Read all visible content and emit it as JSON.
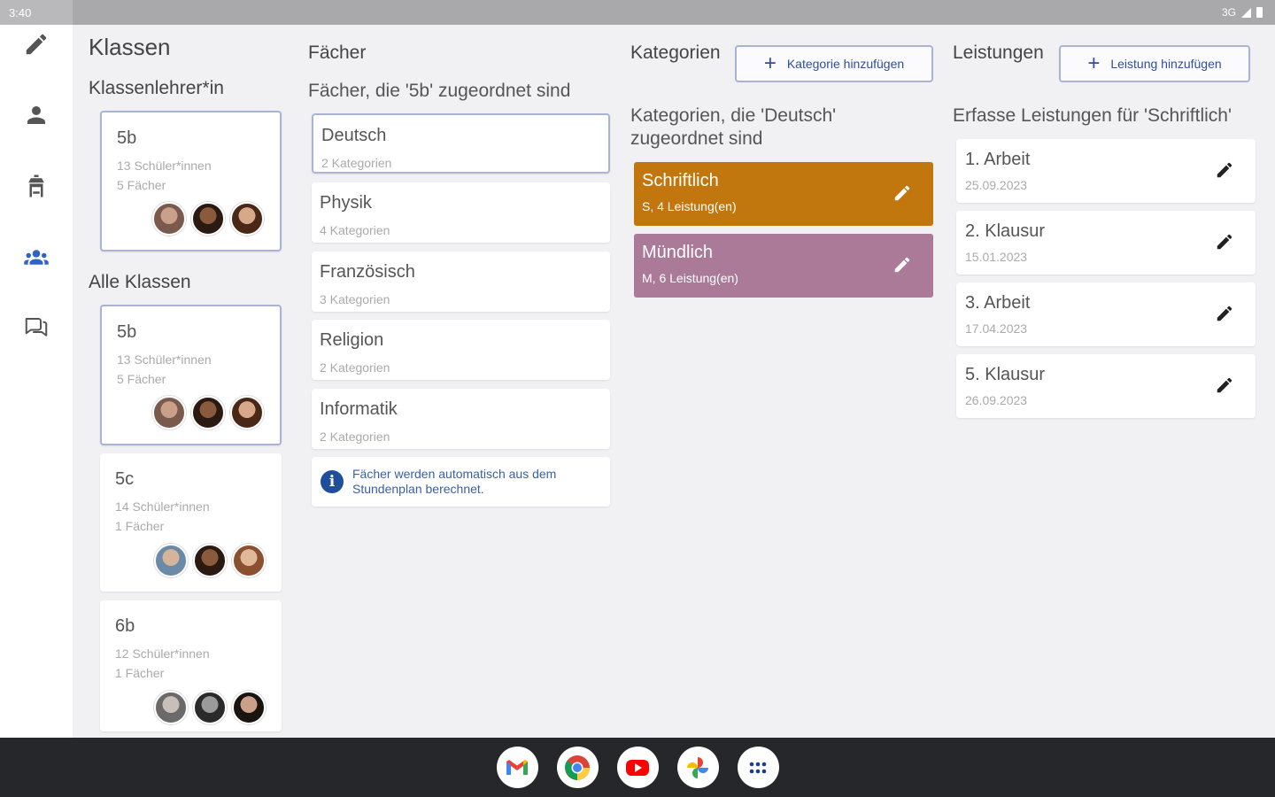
{
  "status": {
    "time": "3:40",
    "network": "3G"
  },
  "nav": {
    "items": [
      {
        "name": "edit"
      },
      {
        "name": "person"
      },
      {
        "name": "school"
      },
      {
        "name": "groups",
        "active": true
      },
      {
        "name": "chat"
      }
    ],
    "active_color": "#2f63c4"
  },
  "classes": {
    "title": "Klassen",
    "teacher_heading": "Klassenlehrer*in",
    "all_heading": "Alle Klassen",
    "teacher_class": {
      "name": "5b",
      "students": "13 Schüler*innen",
      "subjects": "5 Fächer"
    },
    "list": [
      {
        "name": "5b",
        "students": "13 Schüler*innen",
        "subjects": "5 Fächer"
      },
      {
        "name": "5c",
        "students": "14 Schüler*innen",
        "subjects": "1 Fächer"
      },
      {
        "name": "6b",
        "students": "12 Schüler*innen",
        "subjects": "1 Fächer"
      }
    ]
  },
  "subjects": {
    "title": "Fächer",
    "subtitle": "Fächer, die '5b' zugeordnet sind",
    "items": [
      {
        "name": "Deutsch",
        "meta": "2 Kategorien"
      },
      {
        "name": "Physik",
        "meta": "4 Kategorien"
      },
      {
        "name": "Französisch",
        "meta": "3 Kategorien"
      },
      {
        "name": "Religion",
        "meta": "2 Kategorien"
      },
      {
        "name": "Informatik",
        "meta": "2 Kategorien"
      }
    ],
    "info": "Fächer werden automatisch aus dem Stundenplan berechnet."
  },
  "categories": {
    "title": "Kategorien",
    "add_label": "Kategorie hinzufügen",
    "subtitle_line1": "Kategorien, die 'Deutsch'",
    "subtitle_line2": "zugeordnet sind",
    "items": [
      {
        "name": "Schriftlich",
        "meta": "S, 4 Leistung(en)",
        "color": "#c2760e"
      },
      {
        "name": "Mündlich",
        "meta": "M, 6 Leistung(en)",
        "color": "#ab7a98"
      }
    ]
  },
  "performances": {
    "title": "Leistungen",
    "add_label": "Leistung hinzufügen",
    "subtitle": "Erfasse Leistungen für 'Schriftlich'",
    "items": [
      {
        "name": "1. Arbeit",
        "date": "25.09.2023"
      },
      {
        "name": "2. Klausur",
        "date": "15.01.2023"
      },
      {
        "name": "3. Arbeit",
        "date": "17.04.2023"
      },
      {
        "name": "5. Klausur",
        "date": "26.09.2023"
      }
    ]
  },
  "taskbar": {
    "apps": [
      "gmail",
      "chrome",
      "youtube",
      "photos",
      "app-launcher"
    ]
  }
}
